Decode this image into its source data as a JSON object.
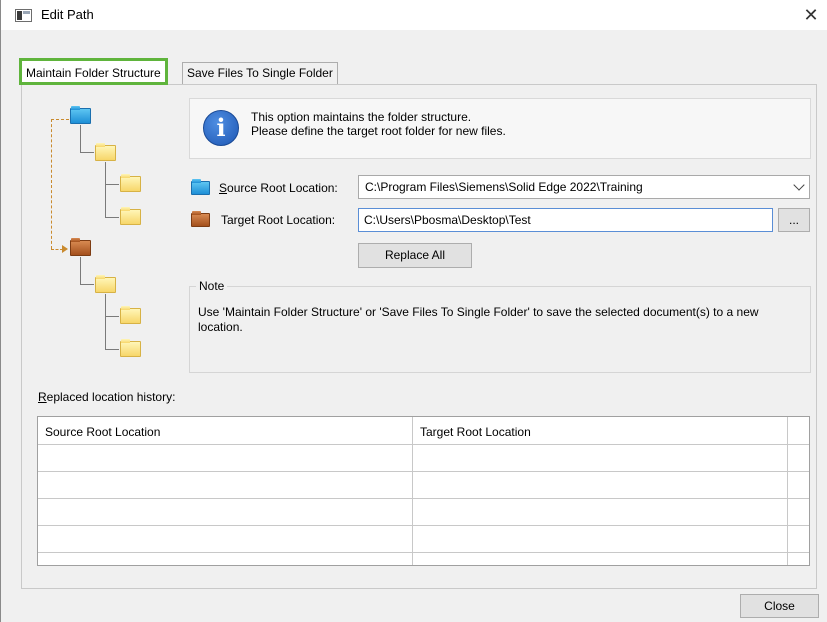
{
  "window": {
    "title": "Edit Path",
    "close_glyph": "✕"
  },
  "tabs": [
    {
      "label": "Maintain Folder Structure",
      "active": true
    },
    {
      "label": "Save Files To Single Folder",
      "active": false
    }
  ],
  "info": {
    "icon": "info-icon",
    "icon_glyph": "i",
    "line1": "This option maintains the folder structure.",
    "line2": "Please define the target root folder for new files."
  },
  "source": {
    "label_pre": "",
    "label_ul": "S",
    "label_post": "ource Root Location:",
    "value": "C:\\Program Files\\Siemens\\Solid Edge 2022\\Training"
  },
  "target": {
    "label_pre": "Tar",
    "label_ul": "g",
    "label_post": "et Root Location:",
    "value": "C:\\Users\\Pbosma\\Desktop\\Test",
    "browse_label": "..."
  },
  "replace_all_label": "Replace All",
  "note": {
    "legend": "Note",
    "text": "Use 'Maintain Folder Structure' or 'Save Files To Single Folder' to save the selected document(s) to a new location."
  },
  "history": {
    "label_ul": "R",
    "label_post": "eplaced location history:",
    "columns": [
      "Source Root Location",
      "Target Root Location"
    ],
    "rows": []
  },
  "close_label": "Close",
  "colors": {
    "active_tab_border": "#5fb43c",
    "source_folder": "#1e8fd6",
    "target_folder": "#a4501c",
    "tree_folder": "#f7d66a"
  }
}
